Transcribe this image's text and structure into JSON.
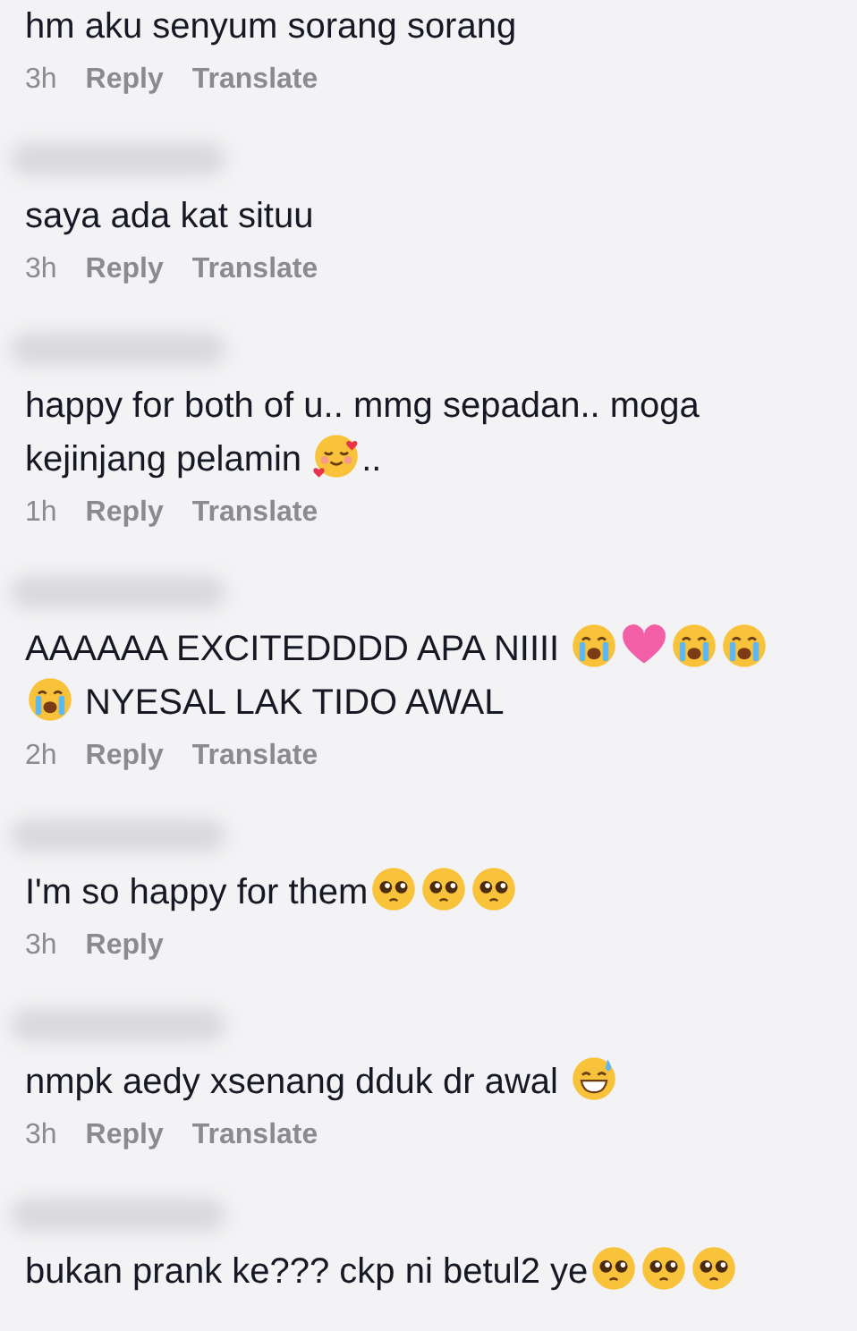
{
  "comments": [
    {
      "username_blurred": false,
      "parts": [
        {
          "kind": "text",
          "text": "hm aku senyum sorang sorang"
        }
      ],
      "time": "3h",
      "actions": [
        "Reply",
        "Translate"
      ]
    },
    {
      "username_blurred": true,
      "parts": [
        {
          "kind": "text",
          "text": "saya ada kat situu"
        }
      ],
      "time": "3h",
      "actions": [
        "Reply",
        "Translate"
      ]
    },
    {
      "username_blurred": true,
      "parts": [
        {
          "kind": "text",
          "text": "happy for both of u.. mmg sepadan.. moga kejinjang pelamin "
        },
        {
          "kind": "hearts"
        },
        {
          "kind": "text",
          "text": ".."
        }
      ],
      "time": "1h",
      "actions": [
        "Reply",
        "Translate"
      ]
    },
    {
      "username_blurred": true,
      "parts": [
        {
          "kind": "text",
          "text": "AAAAAA EXCITEDDDD APA NIIII "
        },
        {
          "kind": "crying"
        },
        {
          "kind": "heart"
        },
        {
          "kind": "crying"
        },
        {
          "kind": "crying"
        },
        {
          "kind": "break"
        },
        {
          "kind": "crying"
        },
        {
          "kind": "text",
          "text": " NYESAL LAK TIDO AWAL"
        }
      ],
      "time": "2h",
      "actions": [
        "Reply",
        "Translate"
      ]
    },
    {
      "username_blurred": true,
      "parts": [
        {
          "kind": "text",
          "text": "I'm so happy for them"
        },
        {
          "kind": "pleading"
        },
        {
          "kind": "pleading"
        },
        {
          "kind": "pleading"
        }
      ],
      "time": "3h",
      "actions": [
        "Reply"
      ]
    },
    {
      "username_blurred": true,
      "parts": [
        {
          "kind": "text",
          "text": "nmpk aedy xsenang dduk dr awal "
        },
        {
          "kind": "sweat"
        }
      ],
      "time": "3h",
      "actions": [
        "Reply",
        "Translate"
      ]
    },
    {
      "username_blurred": true,
      "parts": [
        {
          "kind": "text",
          "text": "bukan prank ke??? ckp ni betul2 ye"
        },
        {
          "kind": "pleading"
        },
        {
          "kind": "pleading"
        },
        {
          "kind": "pleading"
        }
      ]
    }
  ]
}
